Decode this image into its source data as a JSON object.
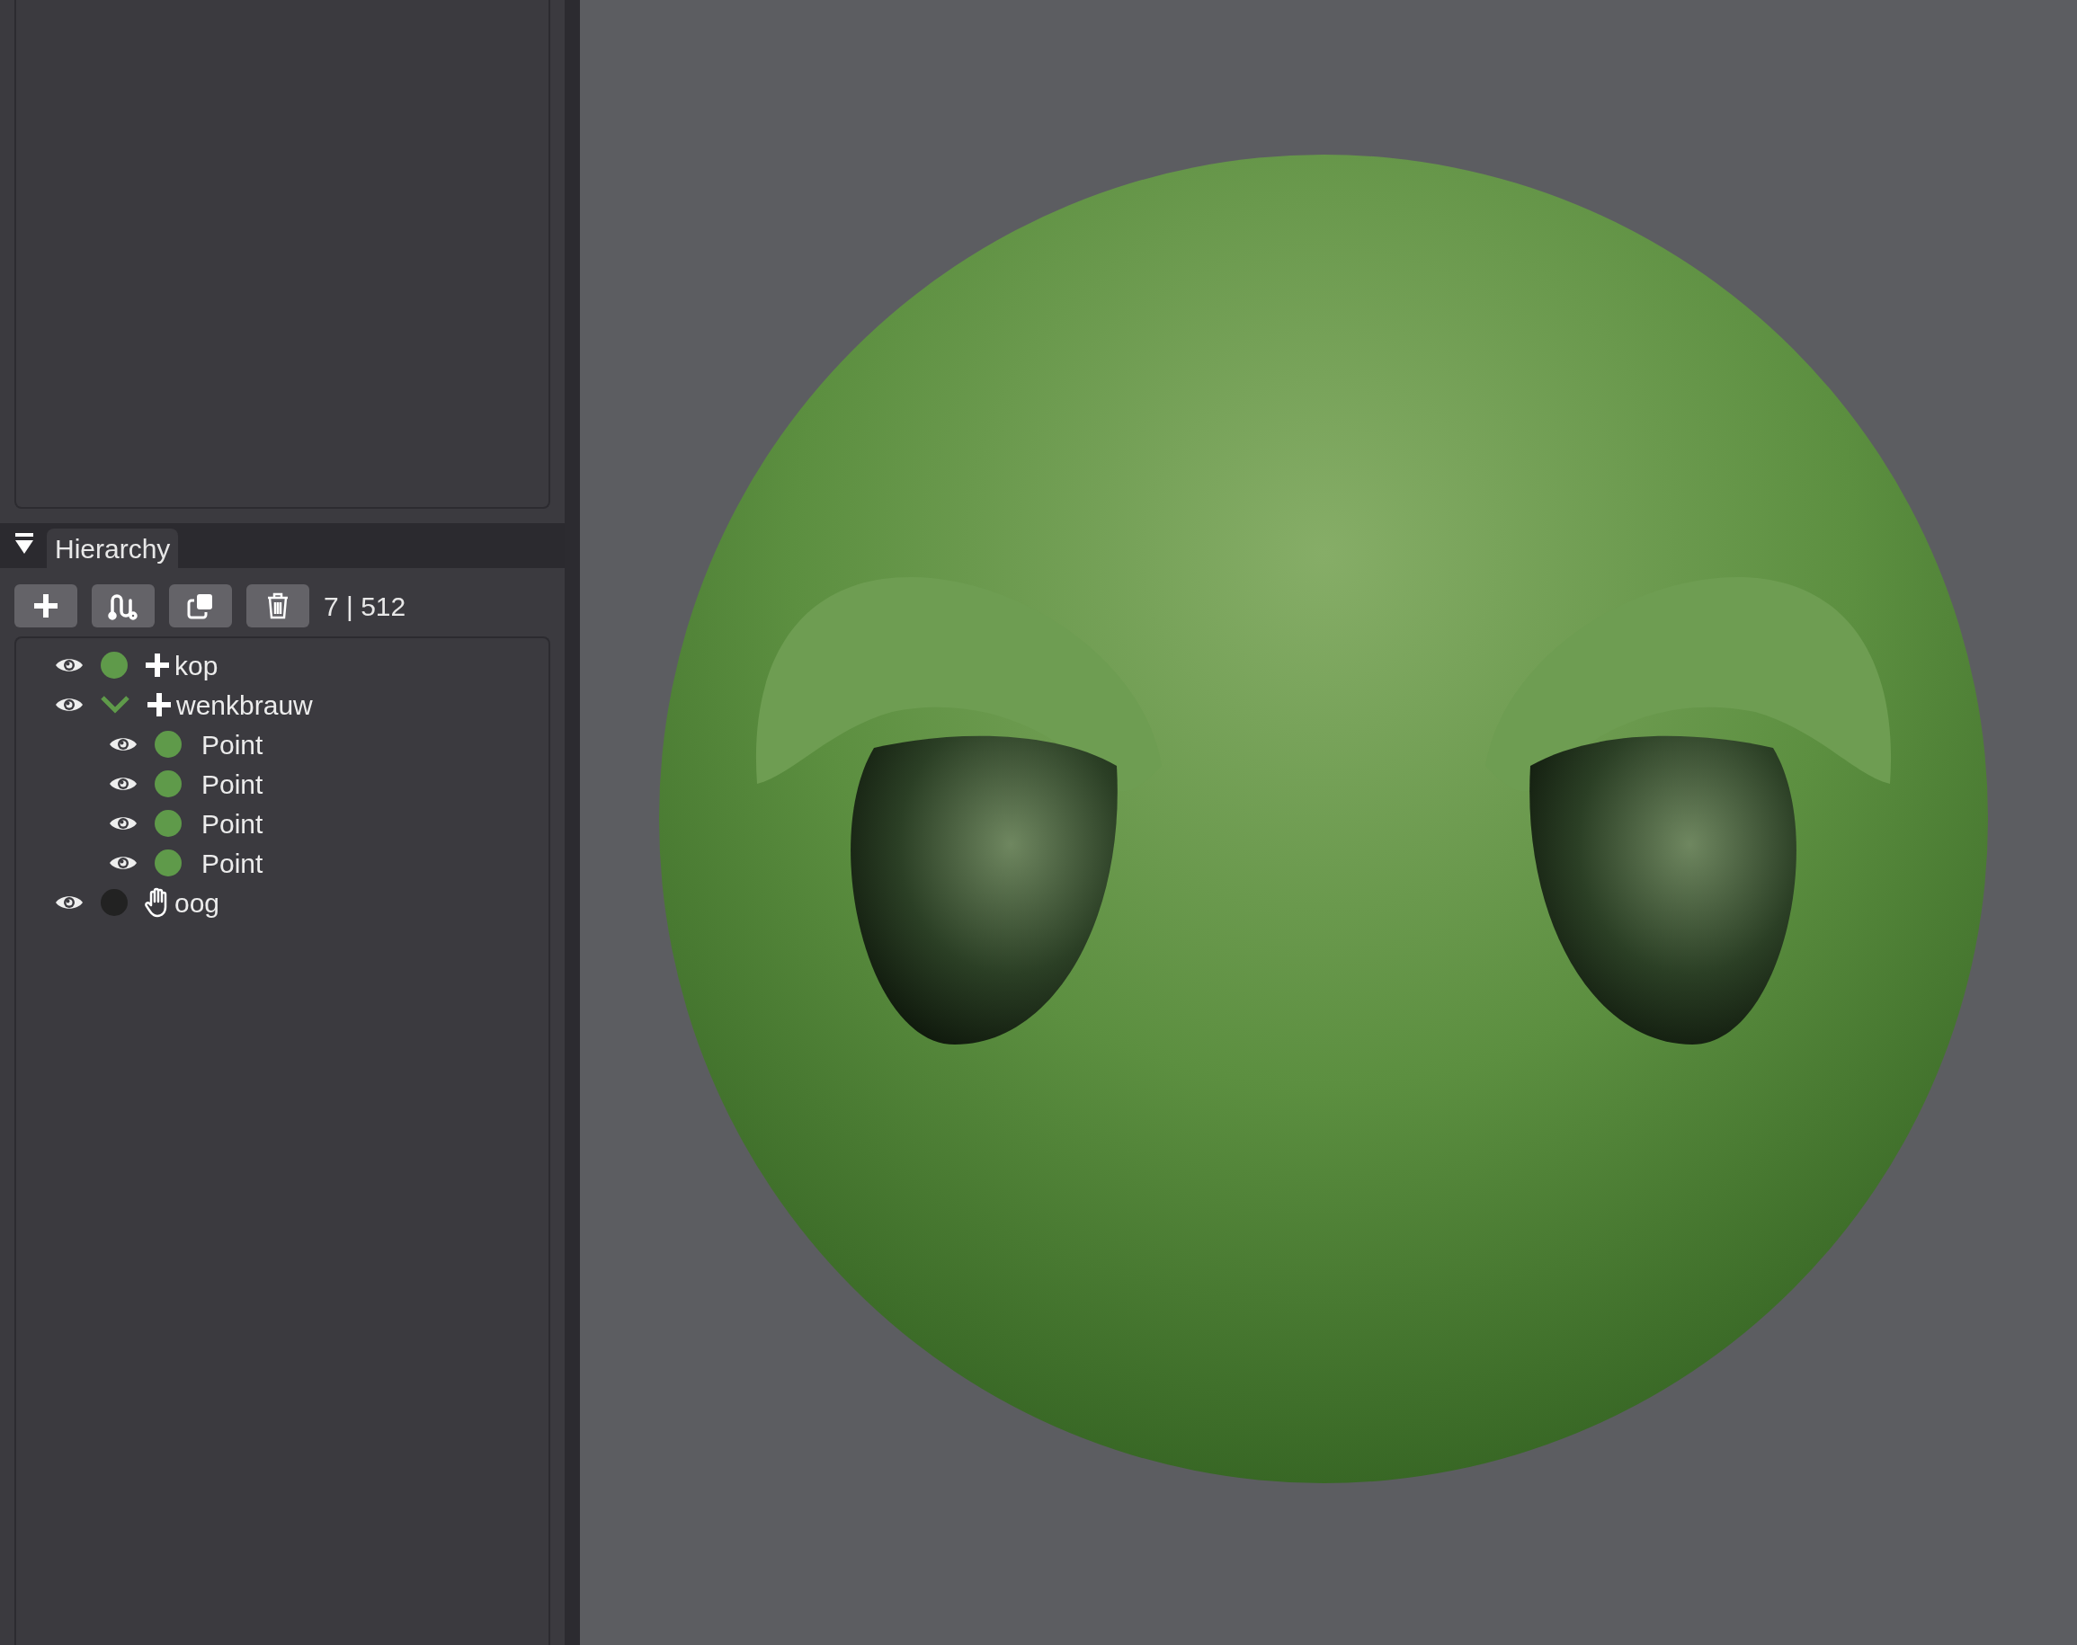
{
  "hierarchy": {
    "title": "Hierarchy",
    "count": "7 | 512",
    "items": [
      {
        "name": "kop",
        "kind": "add",
        "visible": true,
        "color": "#5f9a4a",
        "expanded": false
      },
      {
        "name": "wenkbrauw",
        "kind": "add",
        "visible": true,
        "color": "#5f9a4a",
        "expanded": true,
        "children": [
          {
            "name": "Point",
            "kind": "point",
            "visible": true,
            "color": "#5f9a4a"
          },
          {
            "name": "Point",
            "kind": "point",
            "visible": true,
            "color": "#5f9a4a"
          },
          {
            "name": "Point",
            "kind": "point",
            "visible": true,
            "color": "#5f9a4a"
          },
          {
            "name": "Point",
            "kind": "point",
            "visible": true,
            "color": "#5f9a4a"
          }
        ]
      },
      {
        "name": "oog",
        "kind": "grab",
        "visible": true,
        "color": "#222222",
        "expanded": false
      }
    ]
  }
}
